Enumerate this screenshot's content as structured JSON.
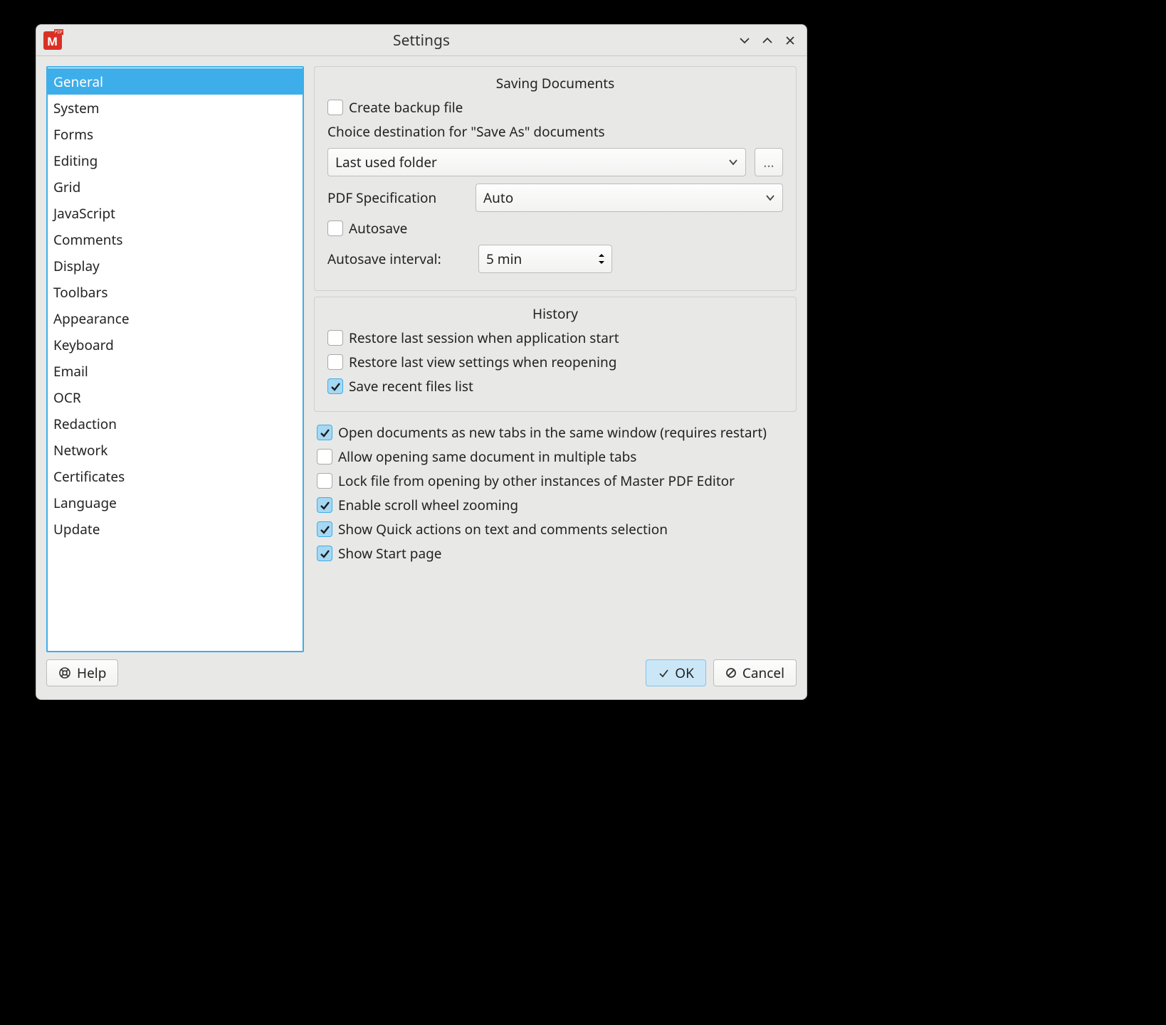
{
  "window": {
    "title": "Settings"
  },
  "sidebar": {
    "items": [
      "General",
      "System",
      "Forms",
      "Editing",
      "Grid",
      "JavaScript",
      "Comments",
      "Display",
      "Toolbars",
      "Appearance",
      "Keyboard",
      "Email",
      "OCR",
      "Redaction",
      "Network",
      "Certificates",
      "Language",
      "Update"
    ],
    "selected_index": 0
  },
  "saving": {
    "title": "Saving Documents",
    "create_backup": {
      "label": "Create backup file",
      "checked": false
    },
    "dest_desc": "Choice destination for \"Save As\" documents",
    "dest_select": "Last used folder",
    "browse_label": "...",
    "pdf_spec_label": "PDF Specification",
    "pdf_spec_value": "Auto",
    "autosave": {
      "label": "Autosave",
      "checked": false
    },
    "autosave_interval_label": "Autosave interval:",
    "autosave_interval_value": "5 min"
  },
  "history": {
    "title": "History",
    "restore_session": {
      "label": "Restore last session when application start",
      "checked": false
    },
    "restore_view": {
      "label": "Restore last view settings when reopening",
      "checked": false
    },
    "save_recent": {
      "label": "Save recent files list",
      "checked": true
    }
  },
  "options": {
    "new_tabs": {
      "label": "Open documents as new tabs in the same window (requires restart)",
      "checked": true
    },
    "multi_tabs": {
      "label": "Allow opening same document in multiple tabs",
      "checked": false
    },
    "lock_file": {
      "label": "Lock file from opening by other instances of Master PDF Editor",
      "checked": false
    },
    "scroll_zoom": {
      "label": "Enable scroll wheel zooming",
      "checked": true
    },
    "quick_actions": {
      "label": "Show Quick actions on text and comments selection",
      "checked": true
    },
    "start_page": {
      "label": "Show Start page",
      "checked": true
    }
  },
  "footer": {
    "help": "Help",
    "ok": "OK",
    "cancel": "Cancel"
  }
}
